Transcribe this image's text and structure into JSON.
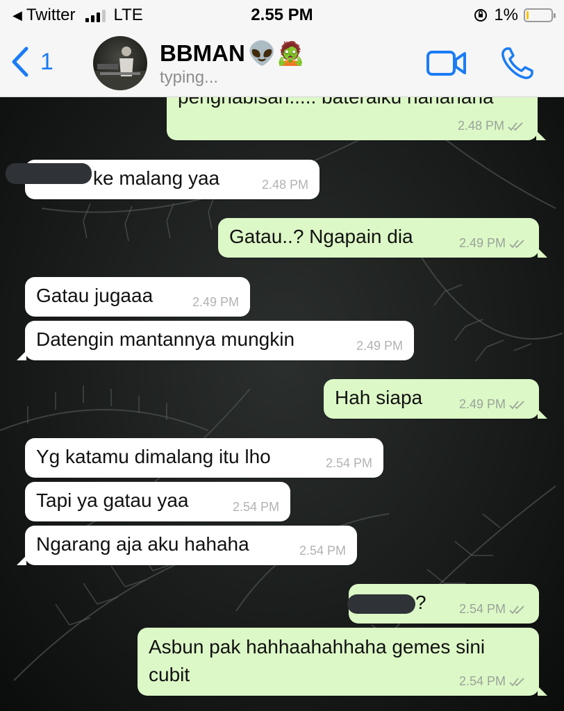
{
  "status_bar": {
    "back_app": "Twitter",
    "network": "LTE",
    "time": "2.55 PM",
    "battery": "1%",
    "battery_level": 0.01,
    "signal_bars": 3
  },
  "header": {
    "back_count": "1",
    "contact_name": "BBMAN",
    "contact_emoji": "👽🧟",
    "status": "typing...",
    "video_icon": "video-call-icon",
    "call_icon": "phone-icon"
  },
  "colors": {
    "accent": "#1a7cf5",
    "outgoing_bubble": "#dcf8c6",
    "incoming_bubble": "#ffffff",
    "battery_low": "#f5c400"
  },
  "messages": [
    {
      "dir": "out",
      "text": "penghabisan..... bateraiku hahahaha",
      "time": "2.48 PM"
    },
    {
      "dir": "in",
      "text": "ke malang yaa",
      "time": "2.48 PM",
      "redacted_prefix": true
    },
    {
      "dir": "out",
      "text": "Gatau..? Ngapain dia",
      "time": "2.49 PM"
    },
    {
      "dir": "in",
      "text": "Gatau jugaaa",
      "time": "2.49 PM"
    },
    {
      "dir": "in",
      "text": "Datengin mantannya mungkin",
      "time": "2.49 PM"
    },
    {
      "dir": "out",
      "text": "Hah siapa",
      "time": "2.49 PM"
    },
    {
      "dir": "in",
      "text": "Yg katamu dimalang itu lho",
      "time": "2.54 PM"
    },
    {
      "dir": "in",
      "text": "Tapi ya gatau yaa",
      "time": "2.54 PM"
    },
    {
      "dir": "in",
      "text": "Ngarang aja aku hahaha",
      "time": "2.54 PM"
    },
    {
      "dir": "out",
      "text": "?",
      "time": "2.54 PM",
      "redacted_prefix": true
    },
    {
      "dir": "out",
      "text_line1": "Asbun pak hahhaahahhaha gemes sini",
      "text_line2": "cubit",
      "time": "2.54 PM"
    }
  ]
}
